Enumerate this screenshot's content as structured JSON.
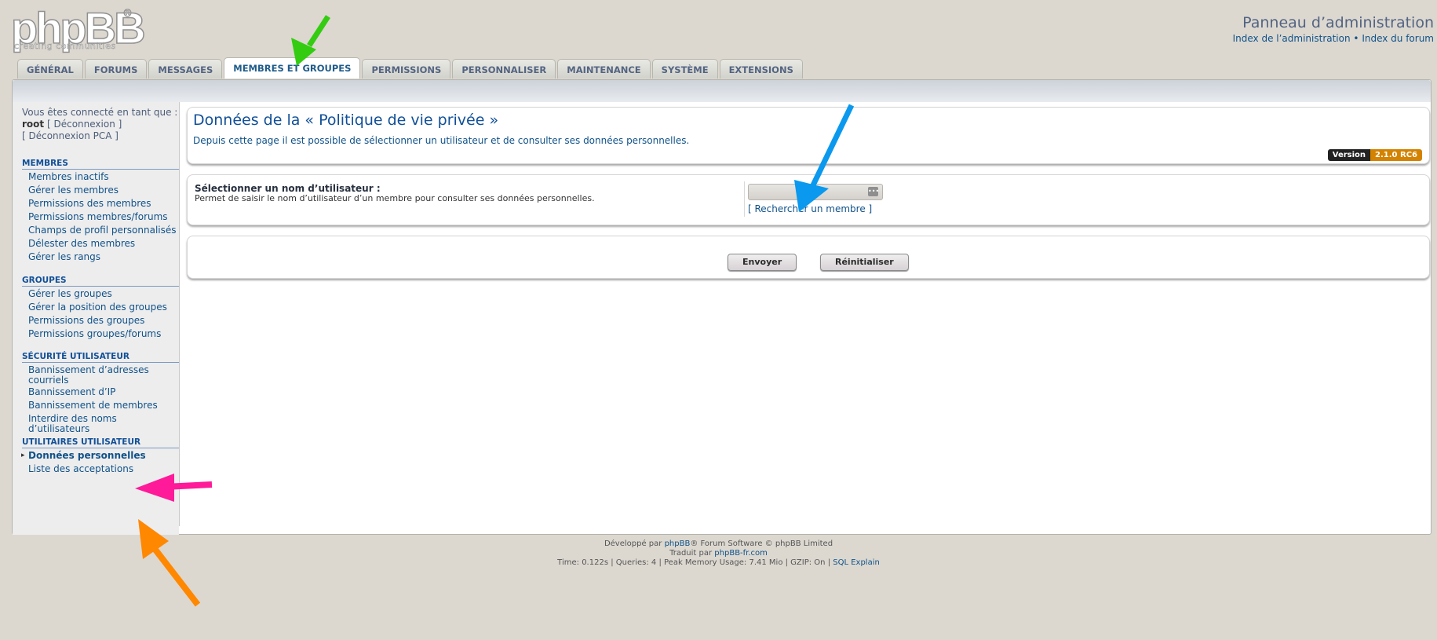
{
  "header": {
    "logo_text": "phpBB",
    "logo_tagline": "creating communities",
    "logo_reg": "®",
    "title": "Panneau d’administration",
    "link_acp_index": "Index de l’administration",
    "link_sep": " • ",
    "link_forum_index": "Index du forum"
  },
  "tabs": [
    "Général",
    "Forums",
    "Messages",
    "Membres et groupes",
    "Permissions",
    "Personnaliser",
    "Maintenance",
    "Système",
    "Extensions"
  ],
  "active_tab": "Membres et groupes",
  "user_info": {
    "line1": "Vous êtes connecté en tant que :",
    "username": "root",
    "logout": "[ Déconnexion ]",
    "acp_logout": "[ Déconnexion PCA ]"
  },
  "sidebar": {
    "sections": [
      {
        "title": "Membres",
        "items": [
          "Membres inactifs",
          "Gérer les membres",
          "Permissions des membres",
          "Permissions membres/forums",
          "Champs de profil personnalisés",
          "Délester des membres",
          "Gérer les rangs"
        ]
      },
      {
        "title": "Groupes",
        "items": [
          "Gérer les groupes",
          "Gérer la position des groupes",
          "Permissions des groupes",
          "Permissions groupes/forums"
        ]
      },
      {
        "title": "Sécurité utilisateur",
        "items": [
          "Bannissement d’adresses courriels",
          "Bannissement d’IP",
          "Bannissement de membres",
          "Interdire des noms d’utilisateurs"
        ]
      },
      {
        "title": "Utilitaires utilisateur",
        "items": [
          "Données personnelles",
          "Liste des acceptations"
        ]
      }
    ],
    "active_item": "Données personnelles"
  },
  "main": {
    "title": "Données de la « Politique de vie privée »",
    "description": "Depuis cette page il est possible de sélectionner un utilisateur et de consulter ses données personnelles.",
    "version_label": "Version",
    "version_value": "2.1.0 RC6",
    "field_label": "Sélectionner un nom d’utilisateur :",
    "field_hint": "Permet de saisir le nom d’utilisateur d’un membre pour consulter ses données personnelles.",
    "username_value": "",
    "search_member": "[ Rechercher un membre ]",
    "submit": "Envoyer",
    "reset": "Réinitialiser"
  },
  "footer": {
    "line1_prefix": "Développé par ",
    "line1_link": "phpBB",
    "line1_suffix": "® Forum Software © phpBB Limited",
    "line2_prefix": "Traduit par ",
    "line2_link": "phpBB-fr.com",
    "line3": "Time: 0.122s | Queries: 4 | Peak Memory Usage: 7.41 Mio | GZIP: On | ",
    "line3_link": "SQL Explain"
  },
  "colors": {
    "accent": "#105289",
    "version_badge": "#d38300",
    "arrow_green": "#33cc11",
    "arrow_blue": "#0a99ee",
    "arrow_pink": "#ff1a99",
    "arrow_orange": "#ff8800"
  }
}
